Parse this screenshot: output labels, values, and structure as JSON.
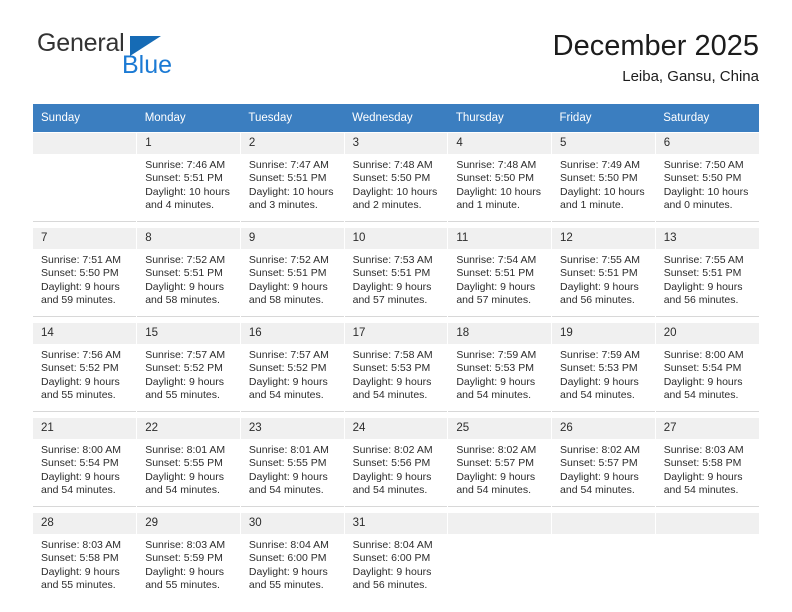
{
  "brand": {
    "line1": "General",
    "line2": "Blue",
    "triangle_color": "#166bb5",
    "text_color": "#333333",
    "blue_color": "#1b7ad4"
  },
  "header": {
    "title": "December 2025",
    "subtitle": "Leiba, Gansu, China"
  },
  "theme": {
    "header_row_bg": "#3b7ec0",
    "daynum_bg": "#f0f0f0",
    "text": "#2c2c2c"
  },
  "weekday_headers": [
    "Sunday",
    "Monday",
    "Tuesday",
    "Wednesday",
    "Thursday",
    "Friday",
    "Saturday"
  ],
  "weeks": [
    [
      {
        "day": "",
        "sunrise": "",
        "sunset": "",
        "daylight1": "",
        "daylight2": "",
        "empty": true
      },
      {
        "day": "1",
        "sunrise": "Sunrise: 7:46 AM",
        "sunset": "Sunset: 5:51 PM",
        "daylight1": "Daylight: 10 hours",
        "daylight2": "and 4 minutes."
      },
      {
        "day": "2",
        "sunrise": "Sunrise: 7:47 AM",
        "sunset": "Sunset: 5:51 PM",
        "daylight1": "Daylight: 10 hours",
        "daylight2": "and 3 minutes."
      },
      {
        "day": "3",
        "sunrise": "Sunrise: 7:48 AM",
        "sunset": "Sunset: 5:50 PM",
        "daylight1": "Daylight: 10 hours",
        "daylight2": "and 2 minutes."
      },
      {
        "day": "4",
        "sunrise": "Sunrise: 7:48 AM",
        "sunset": "Sunset: 5:50 PM",
        "daylight1": "Daylight: 10 hours",
        "daylight2": "and 1 minute."
      },
      {
        "day": "5",
        "sunrise": "Sunrise: 7:49 AM",
        "sunset": "Sunset: 5:50 PM",
        "daylight1": "Daylight: 10 hours",
        "daylight2": "and 1 minute."
      },
      {
        "day": "6",
        "sunrise": "Sunrise: 7:50 AM",
        "sunset": "Sunset: 5:50 PM",
        "daylight1": "Daylight: 10 hours",
        "daylight2": "and 0 minutes."
      }
    ],
    [
      {
        "day": "7",
        "sunrise": "Sunrise: 7:51 AM",
        "sunset": "Sunset: 5:50 PM",
        "daylight1": "Daylight: 9 hours",
        "daylight2": "and 59 minutes."
      },
      {
        "day": "8",
        "sunrise": "Sunrise: 7:52 AM",
        "sunset": "Sunset: 5:51 PM",
        "daylight1": "Daylight: 9 hours",
        "daylight2": "and 58 minutes."
      },
      {
        "day": "9",
        "sunrise": "Sunrise: 7:52 AM",
        "sunset": "Sunset: 5:51 PM",
        "daylight1": "Daylight: 9 hours",
        "daylight2": "and 58 minutes."
      },
      {
        "day": "10",
        "sunrise": "Sunrise: 7:53 AM",
        "sunset": "Sunset: 5:51 PM",
        "daylight1": "Daylight: 9 hours",
        "daylight2": "and 57 minutes."
      },
      {
        "day": "11",
        "sunrise": "Sunrise: 7:54 AM",
        "sunset": "Sunset: 5:51 PM",
        "daylight1": "Daylight: 9 hours",
        "daylight2": "and 57 minutes."
      },
      {
        "day": "12",
        "sunrise": "Sunrise: 7:55 AM",
        "sunset": "Sunset: 5:51 PM",
        "daylight1": "Daylight: 9 hours",
        "daylight2": "and 56 minutes."
      },
      {
        "day": "13",
        "sunrise": "Sunrise: 7:55 AM",
        "sunset": "Sunset: 5:51 PM",
        "daylight1": "Daylight: 9 hours",
        "daylight2": "and 56 minutes."
      }
    ],
    [
      {
        "day": "14",
        "sunrise": "Sunrise: 7:56 AM",
        "sunset": "Sunset: 5:52 PM",
        "daylight1": "Daylight: 9 hours",
        "daylight2": "and 55 minutes."
      },
      {
        "day": "15",
        "sunrise": "Sunrise: 7:57 AM",
        "sunset": "Sunset: 5:52 PM",
        "daylight1": "Daylight: 9 hours",
        "daylight2": "and 55 minutes."
      },
      {
        "day": "16",
        "sunrise": "Sunrise: 7:57 AM",
        "sunset": "Sunset: 5:52 PM",
        "daylight1": "Daylight: 9 hours",
        "daylight2": "and 54 minutes."
      },
      {
        "day": "17",
        "sunrise": "Sunrise: 7:58 AM",
        "sunset": "Sunset: 5:53 PM",
        "daylight1": "Daylight: 9 hours",
        "daylight2": "and 54 minutes."
      },
      {
        "day": "18",
        "sunrise": "Sunrise: 7:59 AM",
        "sunset": "Sunset: 5:53 PM",
        "daylight1": "Daylight: 9 hours",
        "daylight2": "and 54 minutes."
      },
      {
        "day": "19",
        "sunrise": "Sunrise: 7:59 AM",
        "sunset": "Sunset: 5:53 PM",
        "daylight1": "Daylight: 9 hours",
        "daylight2": "and 54 minutes."
      },
      {
        "day": "20",
        "sunrise": "Sunrise: 8:00 AM",
        "sunset": "Sunset: 5:54 PM",
        "daylight1": "Daylight: 9 hours",
        "daylight2": "and 54 minutes."
      }
    ],
    [
      {
        "day": "21",
        "sunrise": "Sunrise: 8:00 AM",
        "sunset": "Sunset: 5:54 PM",
        "daylight1": "Daylight: 9 hours",
        "daylight2": "and 54 minutes."
      },
      {
        "day": "22",
        "sunrise": "Sunrise: 8:01 AM",
        "sunset": "Sunset: 5:55 PM",
        "daylight1": "Daylight: 9 hours",
        "daylight2": "and 54 minutes."
      },
      {
        "day": "23",
        "sunrise": "Sunrise: 8:01 AM",
        "sunset": "Sunset: 5:55 PM",
        "daylight1": "Daylight: 9 hours",
        "daylight2": "and 54 minutes."
      },
      {
        "day": "24",
        "sunrise": "Sunrise: 8:02 AM",
        "sunset": "Sunset: 5:56 PM",
        "daylight1": "Daylight: 9 hours",
        "daylight2": "and 54 minutes."
      },
      {
        "day": "25",
        "sunrise": "Sunrise: 8:02 AM",
        "sunset": "Sunset: 5:57 PM",
        "daylight1": "Daylight: 9 hours",
        "daylight2": "and 54 minutes."
      },
      {
        "day": "26",
        "sunrise": "Sunrise: 8:02 AM",
        "sunset": "Sunset: 5:57 PM",
        "daylight1": "Daylight: 9 hours",
        "daylight2": "and 54 minutes."
      },
      {
        "day": "27",
        "sunrise": "Sunrise: 8:03 AM",
        "sunset": "Sunset: 5:58 PM",
        "daylight1": "Daylight: 9 hours",
        "daylight2": "and 54 minutes."
      }
    ],
    [
      {
        "day": "28",
        "sunrise": "Sunrise: 8:03 AM",
        "sunset": "Sunset: 5:58 PM",
        "daylight1": "Daylight: 9 hours",
        "daylight2": "and 55 minutes."
      },
      {
        "day": "29",
        "sunrise": "Sunrise: 8:03 AM",
        "sunset": "Sunset: 5:59 PM",
        "daylight1": "Daylight: 9 hours",
        "daylight2": "and 55 minutes."
      },
      {
        "day": "30",
        "sunrise": "Sunrise: 8:04 AM",
        "sunset": "Sunset: 6:00 PM",
        "daylight1": "Daylight: 9 hours",
        "daylight2": "and 55 minutes."
      },
      {
        "day": "31",
        "sunrise": "Sunrise: 8:04 AM",
        "sunset": "Sunset: 6:00 PM",
        "daylight1": "Daylight: 9 hours",
        "daylight2": "and 56 minutes."
      },
      {
        "day": "",
        "sunrise": "",
        "sunset": "",
        "daylight1": "",
        "daylight2": "",
        "blank": true
      },
      {
        "day": "",
        "sunrise": "",
        "sunset": "",
        "daylight1": "",
        "daylight2": "",
        "blank": true
      },
      {
        "day": "",
        "sunrise": "",
        "sunset": "",
        "daylight1": "",
        "daylight2": "",
        "blank": true
      }
    ]
  ]
}
